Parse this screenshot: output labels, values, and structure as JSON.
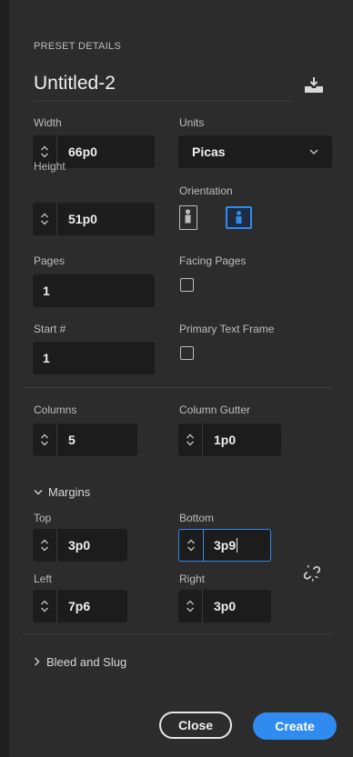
{
  "preset": {
    "section_label": "PRESET DETAILS",
    "name": "Untitled-2"
  },
  "fields": {
    "width": {
      "label": "Width",
      "value": "66p0"
    },
    "units": {
      "label": "Units",
      "value": "Picas"
    },
    "height": {
      "label": "Height",
      "value": "51p0"
    },
    "orientation": {
      "label": "Orientation",
      "selected": "landscape"
    },
    "pages": {
      "label": "Pages",
      "value": "1"
    },
    "facing_pages": {
      "label": "Facing Pages",
      "checked": false
    },
    "start": {
      "label": "Start #",
      "value": "1"
    },
    "primary_text_frame": {
      "label": "Primary Text Frame",
      "checked": false
    },
    "columns": {
      "label": "Columns",
      "value": "5"
    },
    "column_gutter": {
      "label": "Column Gutter",
      "value": "1p0"
    }
  },
  "margins": {
    "header": "Margins",
    "top": {
      "label": "Top",
      "value": "3p0"
    },
    "bottom": {
      "label": "Bottom",
      "value": "3p9"
    },
    "left": {
      "label": "Left",
      "value": "7p6"
    },
    "right": {
      "label": "Right",
      "value": "3p0"
    },
    "linked": false
  },
  "bleed": {
    "header": "Bleed and Slug"
  },
  "buttons": {
    "close": "Close",
    "create": "Create"
  },
  "colors": {
    "accent": "#2f8bf0",
    "panel": "#2c2c2c",
    "field": "#1c1c1c"
  }
}
